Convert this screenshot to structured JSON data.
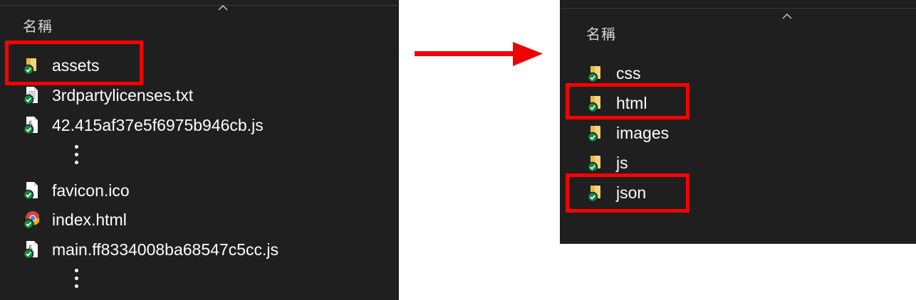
{
  "left_panel": {
    "column_header": "名稱",
    "files_top": [
      {
        "name": "assets",
        "icon": "folder-icon",
        "status": "synced"
      },
      {
        "name": "3rdpartylicenses.txt",
        "icon": "text-file-icon",
        "status": "synced"
      },
      {
        "name": "42.415af37e5f6975b946cb.js",
        "icon": "script-file-icon",
        "status": "synced"
      }
    ],
    "files_bottom": [
      {
        "name": "favicon.ico",
        "icon": "blank-file-icon",
        "status": "synced"
      },
      {
        "name": "index.html",
        "icon": "chrome-icon",
        "status": "synced"
      },
      {
        "name": "main.ff8334008ba68547c5cc.js",
        "icon": "script-file-icon",
        "status": "synced"
      }
    ],
    "highlighted": "assets"
  },
  "right_panel": {
    "column_header": "名稱",
    "folders": [
      {
        "name": "css",
        "icon": "folder-icon",
        "status": "synced"
      },
      {
        "name": "html",
        "icon": "folder-icon",
        "status": "synced"
      },
      {
        "name": "images",
        "icon": "folder-icon",
        "status": "synced"
      },
      {
        "name": "js",
        "icon": "folder-icon",
        "status": "synced"
      },
      {
        "name": "json",
        "icon": "folder-icon",
        "status": "synced"
      }
    ],
    "highlighted": [
      "html",
      "json"
    ]
  },
  "colors": {
    "panel_background": "#1f1f1f",
    "highlight": "#ff0000",
    "arrow": "#ee0000",
    "sync_badge": "#0f8a3c",
    "folder": "#f4d37a"
  }
}
